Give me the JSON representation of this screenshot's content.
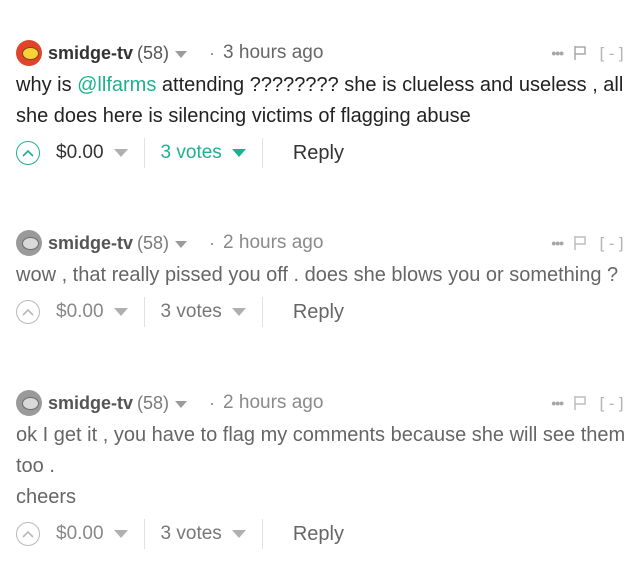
{
  "comments": [
    {
      "author": "smidge-tv",
      "reputation": "(58)",
      "time": "3 hours ago",
      "body_before_mention": "why is ",
      "mention": "@llfarms",
      "body_after_mention": " attending ???????? she is clueless and useless , all she does here is silencing victims of flagging abuse",
      "payout": "$0.00",
      "votes": "3 votes",
      "reply_label": "Reply",
      "collapse_label": "[-]",
      "avatar_color": "#e0452a"
    },
    {
      "author": "smidge-tv",
      "reputation": "(58)",
      "time": "2 hours ago",
      "body": "wow , that really pissed you off . does she blows you or something ?",
      "payout": "$0.00",
      "votes": "3 votes",
      "reply_label": "Reply",
      "collapse_label": "[-]",
      "avatar_color": "#9a9a9a"
    },
    {
      "author": "smidge-tv",
      "reputation": "(58)",
      "time": "2 hours ago",
      "body_line1": "ok I get it , you have to flag my comments because she will see them too .",
      "body_line2": "cheers",
      "payout": "$0.00",
      "votes": "3 votes",
      "reply_label": "Reply",
      "collapse_label": "[-]",
      "avatar_color": "#9a9a9a"
    }
  ],
  "colors": {
    "accent": "#1fb090",
    "text": "#222222",
    "muted": "#888888"
  },
  "icons": {
    "upvote": "chevron-up-circle-icon",
    "dropdown": "caret-down-icon",
    "more": "ellipsis-icon",
    "flag": "flag-icon"
  }
}
